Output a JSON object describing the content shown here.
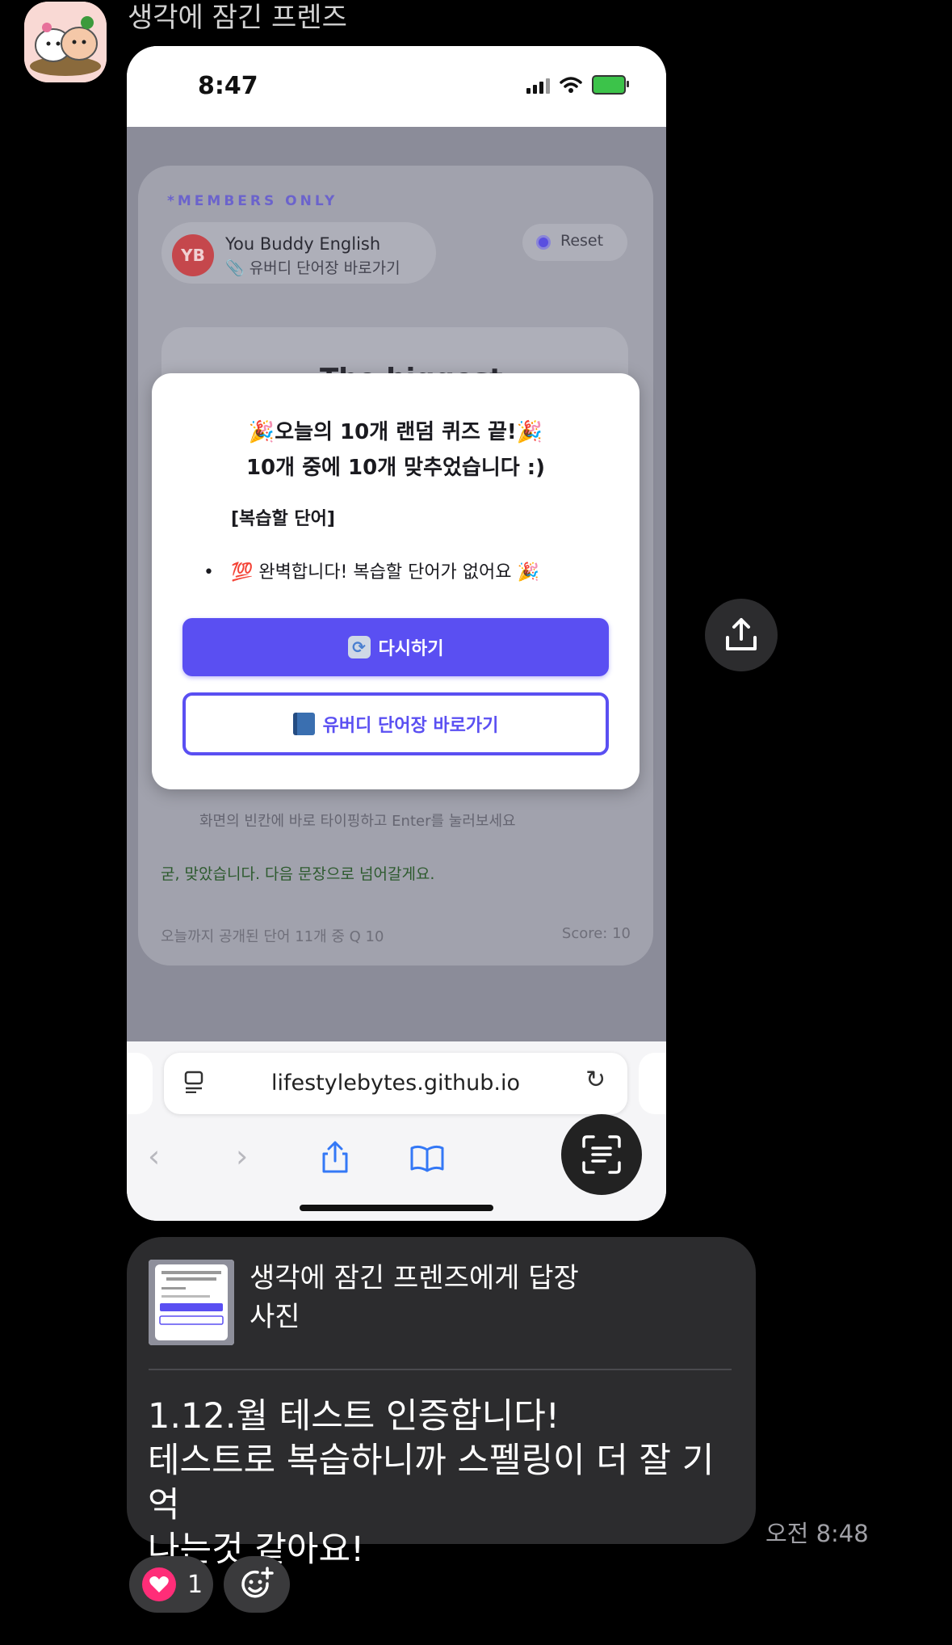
{
  "chat": {
    "sender_name": "생각에 잠긴 프렌즈",
    "reply": {
      "title": "생각에 잠긴 프렌즈에게 답장",
      "subtitle": "사진"
    },
    "message_lines": [
      "1.12.월 테스트 인증합니다!",
      "테스트로 복습하니까 스펠링이 더 잘 기억",
      "나는것 같아요!"
    ],
    "timestamp": "오전 8:48",
    "reactions": {
      "heart_count": "1"
    }
  },
  "screenshot": {
    "clock": "8:47",
    "page": {
      "members_label": "*MEMBERS ONLY",
      "profile_initials": "YB",
      "profile_name": "You Buddy English",
      "profile_link": "📎 유버디 단어장 바로가기",
      "reset_label": "Reset",
      "peek_text": "The biggest",
      "hint": "화면의 빈칸에 바로 타이핑하고 Enter를 눌러보세요",
      "feedback": "굳, 맞았습니다. 다음 문장으로 넘어갈게요.",
      "footer_left": "오늘까지 공개된 단어 11개 중 Q 10",
      "footer_right": "Score: 10"
    },
    "modal": {
      "title": "🎉오늘의 10개 랜덤 퀴즈 끝!🎉",
      "subtitle": "10개 중에 10개 맞추었습니다 :)",
      "review_heading": "[복습할 단어]",
      "bullet": "💯 완벽합니다! 복습할 단어가 없어요 🎉",
      "retry_label": "다시하기",
      "vocab_label": "유버디 단어장 바로가기"
    },
    "browser": {
      "url": "lifestylebytes.github.io"
    }
  },
  "colors": {
    "accent": "#5a4ff2",
    "bubble": "#2c2c2e",
    "heart": "#ff2d78"
  }
}
